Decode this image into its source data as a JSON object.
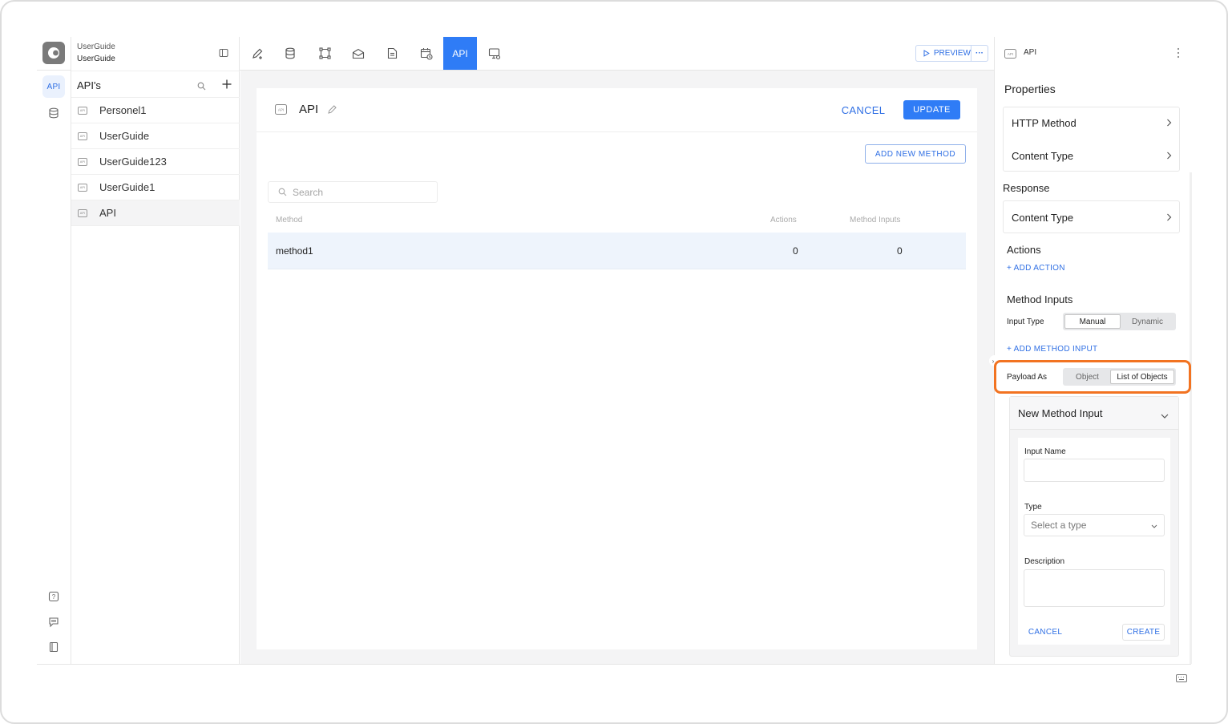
{
  "workspace": {
    "name_line1": "UserGuide",
    "name_line2": "UserGuide"
  },
  "rail": {
    "api_label": "API"
  },
  "list": {
    "title": "API's",
    "items": [
      {
        "label": "Personel1",
        "active": false
      },
      {
        "label": "UserGuide",
        "active": false
      },
      {
        "label": "UserGuide123",
        "active": false
      },
      {
        "label": "UserGuide1",
        "active": false
      },
      {
        "label": "API",
        "active": true
      }
    ]
  },
  "toolbar": {
    "api_tab_label": "API",
    "preview_label": "PREVIEW"
  },
  "editor": {
    "title": "API",
    "cancel_label": "CANCEL",
    "update_label": "UPDATE",
    "add_method_label": "ADD NEW METHOD",
    "search_placeholder": "Search",
    "columns": {
      "method": "Method",
      "actions": "Actions",
      "method_inputs": "Method Inputs"
    },
    "rows": [
      {
        "method": "method1",
        "actions": "0",
        "method_inputs": "0"
      }
    ]
  },
  "properties": {
    "header_label": "API",
    "title": "Properties",
    "request_items": [
      "HTTP Method",
      "Content Type"
    ],
    "response_title": "Response",
    "response_items": [
      "Content Type"
    ],
    "actions_title": "Actions",
    "add_action_label": "+ ADD ACTION",
    "method_inputs_title": "Method Inputs",
    "input_type_label": "Input Type",
    "input_type_options": [
      "Manual",
      "Dynamic"
    ],
    "input_type_selected": "Manual",
    "add_method_input_label": "+ ADD METHOD INPUT",
    "payload_as_label": "Payload As",
    "payload_options": [
      "Object",
      "List of Objects"
    ],
    "payload_selected": "List of Objects",
    "new_input": {
      "title": "New Method Input",
      "input_name_label": "Input Name",
      "input_name_value": "",
      "type_label": "Type",
      "type_placeholder": "Select a type",
      "description_label": "Description",
      "description_value": "",
      "cancel_label": "CANCEL",
      "create_label": "CREATE"
    }
  },
  "colors": {
    "accent": "#2f7cf6",
    "highlight": "#f27321"
  }
}
